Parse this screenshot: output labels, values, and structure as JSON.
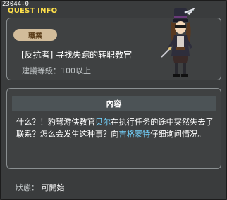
{
  "header": {
    "quest_id": "23044-0",
    "title": "QUEST INFO"
  },
  "quest": {
    "badge": "職業",
    "name": "[反抗者] 寻找失踪的转职教官",
    "level": "建議等級：100以上"
  },
  "content": {
    "title": "內容",
    "desc_part1": "什么？！豹弩游侠教官",
    "npc1": "贝尔",
    "desc_part2": "在执行任务的途中突然失去了联系？怎么会发生这种事？向",
    "npc2": "吉格蒙特",
    "desc_part3": "仔细询问情况。"
  },
  "status": {
    "label": "狀態：",
    "value": "可開始"
  },
  "colors": {
    "title_yellow": "#ffe04a",
    "badge_bg": "#d2bc9a",
    "npc_highlight": "#74d4ff"
  }
}
